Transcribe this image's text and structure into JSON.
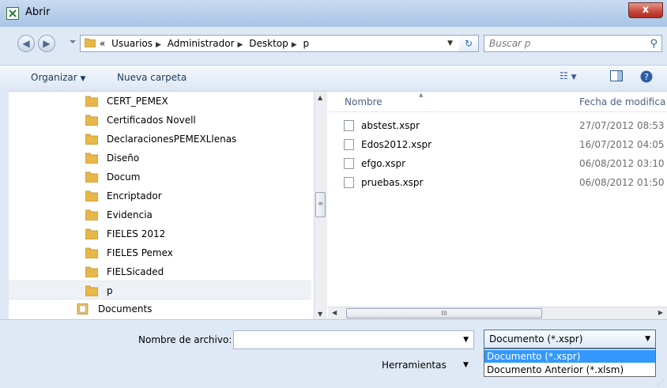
{
  "window": {
    "title": "Abrir",
    "close_label": "x",
    "app_icon": "xspr-doc-icon"
  },
  "address": {
    "crumbs": [
      "«",
      "Usuarios",
      "Administrador",
      "Desktop",
      "p"
    ],
    "search_placeholder": "Buscar p"
  },
  "toolbar": {
    "organize_label": "Organizar",
    "new_folder_label": "Nueva carpeta"
  },
  "nav": {
    "items": [
      {
        "label": "CERT_PEMEX"
      },
      {
        "label": "Certificados Novell"
      },
      {
        "label": "DeclaracionesPEMEXLlenas"
      },
      {
        "label": "Diseño"
      },
      {
        "label": "Docum"
      },
      {
        "label": "Encriptador"
      },
      {
        "label": "Evidencia"
      },
      {
        "label": "FIELES 2012"
      },
      {
        "label": "FIELES Pemex"
      },
      {
        "label": "FIELSicaded"
      },
      {
        "label": "p"
      },
      {
        "label": "Documents"
      }
    ]
  },
  "files": {
    "columns": {
      "name": "Nombre",
      "date": "Fecha de modifica"
    },
    "rows": [
      {
        "name": "abstest.xspr",
        "date": "27/07/2012 08:53 ."
      },
      {
        "name": "Edos2012.xspr",
        "date": "16/07/2012 04:05 ."
      },
      {
        "name": "efgo.xspr",
        "date": "06/08/2012 03:10 ."
      },
      {
        "name": "pruebas.xspr",
        "date": "06/08/2012 01:50 ."
      }
    ]
  },
  "bottom": {
    "filename_label": "Nombre de archivo:",
    "filename_value": "",
    "filter_value": "Documento (*.xspr)",
    "filter_options": [
      "Documento (*.xspr)",
      "Documento Anterior (*.xlsm)"
    ],
    "tools_label": "Herramientas"
  },
  "colors": {
    "accent": "#3399ff",
    "folder": "#e8b74a",
    "titlebar": "#c7daf1"
  }
}
